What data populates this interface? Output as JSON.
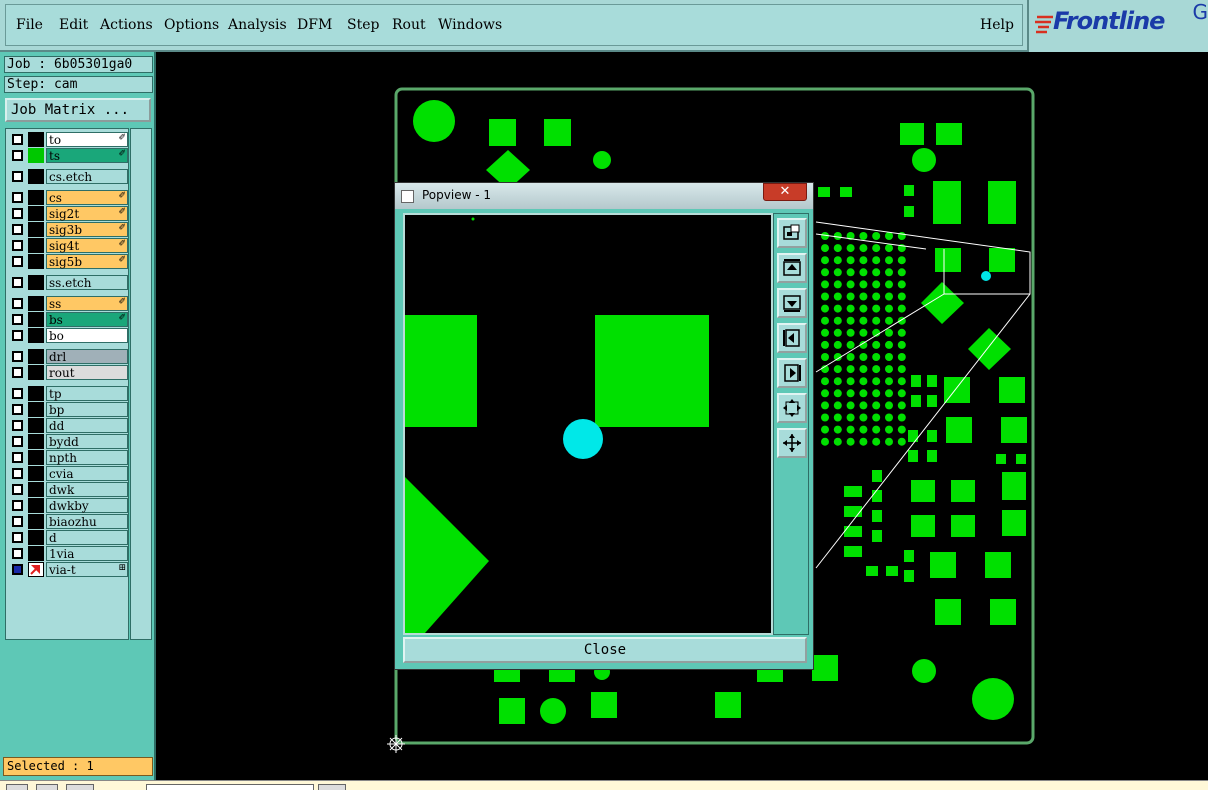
{
  "menubar": {
    "items": [
      "File",
      "Edit",
      "Actions",
      "Options",
      "Analysis",
      "DFM",
      "Step",
      "Rout",
      "Windows"
    ],
    "help": "Help"
  },
  "logo": {
    "text": "Frontline",
    "corner": "G"
  },
  "job": {
    "label": "Job : 6b05301ga0",
    "step": "Step: cam",
    "matrix_button": "Job Matrix ..."
  },
  "layers": [
    {
      "name": "to",
      "bg": "#ffffff",
      "color": "#000000",
      "mark": "✐"
    },
    {
      "name": "ts",
      "bg": "#1aa77a",
      "color": "#00c800",
      "mark": "✐"
    },
    {
      "name": "cs.etch",
      "bg": "#a8dcda",
      "color": "#000000",
      "mark": ""
    },
    {
      "name": "cs",
      "bg": "#ffc864",
      "color": "#000000",
      "mark": "✐"
    },
    {
      "name": "sig2t",
      "bg": "#ffc864",
      "color": "#000000",
      "mark": "✐"
    },
    {
      "name": "sig3b",
      "bg": "#ffc864",
      "color": "#000000",
      "mark": "✐"
    },
    {
      "name": "sig4t",
      "bg": "#ffc864",
      "color": "#000000",
      "mark": "✐"
    },
    {
      "name": "sig5b",
      "bg": "#ffc864",
      "color": "#000000",
      "mark": "✐"
    },
    {
      "name": "ss.etch",
      "bg": "#a8dcda",
      "color": "#000000",
      "mark": ""
    },
    {
      "name": "ss",
      "bg": "#ffc864",
      "color": "#000000",
      "mark": "✐"
    },
    {
      "name": "bs",
      "bg": "#1aa77a",
      "color": "#000000",
      "mark": "✐"
    },
    {
      "name": "bo",
      "bg": "#ffffff",
      "color": "#000000",
      "mark": ""
    },
    {
      "name": "drl",
      "bg": "#a0b0b8",
      "color": "#000000",
      "mark": ""
    },
    {
      "name": "rout",
      "bg": "#dcdcdc",
      "color": "#000000",
      "mark": ""
    },
    {
      "name": "tp",
      "bg": "#a8dcda",
      "color": "#000000",
      "mark": ""
    },
    {
      "name": "bp",
      "bg": "#a8dcda",
      "color": "#000000",
      "mark": ""
    },
    {
      "name": "dd",
      "bg": "#a8dcda",
      "color": "#000000",
      "mark": ""
    },
    {
      "name": "bydd",
      "bg": "#a8dcda",
      "color": "#000000",
      "mark": ""
    },
    {
      "name": "npth",
      "bg": "#a8dcda",
      "color": "#000000",
      "mark": ""
    },
    {
      "name": "cvia",
      "bg": "#a8dcda",
      "color": "#000000",
      "mark": ""
    },
    {
      "name": "dwk",
      "bg": "#a8dcda",
      "color": "#000000",
      "mark": ""
    },
    {
      "name": "dwkby",
      "bg": "#a8dcda",
      "color": "#000000",
      "mark": ""
    },
    {
      "name": "biaozhu",
      "bg": "#a8dcda",
      "color": "#000000",
      "mark": ""
    },
    {
      "name": "d",
      "bg": "#a8dcda",
      "color": "#000000",
      "mark": ""
    },
    {
      "name": "1via",
      "bg": "#a8dcda",
      "color": "#000000",
      "mark": ""
    },
    {
      "name": "via-t",
      "bg": "#a8dcda",
      "color": "#000000",
      "mark": "⊞"
    }
  ],
  "status": {
    "selected": "Selected : 1"
  },
  "popview": {
    "title": "Popview - 1",
    "close_x": "✕",
    "close_button": "Close",
    "tools": [
      "zoom-window-icon",
      "pan-up-icon",
      "pan-down-icon",
      "pan-left-icon",
      "pan-right-icon",
      "zoom-fit-icon",
      "zoom-home-icon"
    ]
  },
  "colors": {
    "pad": "#00e000",
    "highlight": "#00e8e8",
    "board_outline": "#5aa86a",
    "panel": "#5ec8b6"
  }
}
